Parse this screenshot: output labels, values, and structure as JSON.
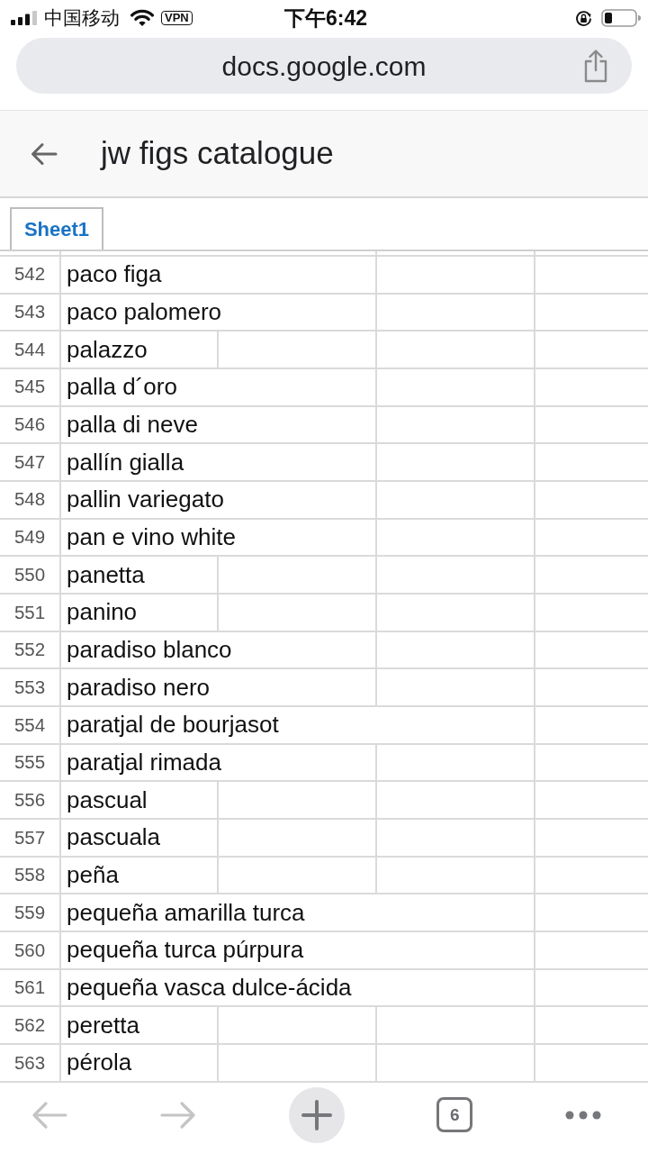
{
  "status_bar": {
    "carrier": "中国移动",
    "vpn": "VPN",
    "time": "下午6:42"
  },
  "address_bar": {
    "url": "docs.google.com"
  },
  "doc_header": {
    "title": "jw figs catalogue"
  },
  "sheet_tabs": [
    {
      "label": "Sheet1",
      "selected": true
    }
  ],
  "sheet": {
    "rows": [
      {
        "number": "542",
        "value": "paco figa",
        "kind": "double"
      },
      {
        "number": "543",
        "value": "paco palomero",
        "kind": "double"
      },
      {
        "number": "544",
        "value": "palazzo",
        "kind": "single"
      },
      {
        "number": "545",
        "value": "palla d´oro",
        "kind": "double"
      },
      {
        "number": "546",
        "value": "palla di neve",
        "kind": "double"
      },
      {
        "number": "547",
        "value": "pallín gialla",
        "kind": "double"
      },
      {
        "number": "548",
        "value": "pallin variegato",
        "kind": "double"
      },
      {
        "number": "549",
        "value": "pan e vino white",
        "kind": "double"
      },
      {
        "number": "550",
        "value": "panetta",
        "kind": "single"
      },
      {
        "number": "551",
        "value": "panino",
        "kind": "single"
      },
      {
        "number": "552",
        "value": "paradiso blanco",
        "kind": "double"
      },
      {
        "number": "553",
        "value": "paradiso nero",
        "kind": "double"
      },
      {
        "number": "554",
        "value": "paratjal de bourjasot",
        "kind": "triple"
      },
      {
        "number": "555",
        "value": "paratjal rimada",
        "kind": "double"
      },
      {
        "number": "556",
        "value": "pascual",
        "kind": "single"
      },
      {
        "number": "557",
        "value": "pascuala",
        "kind": "single"
      },
      {
        "number": "558",
        "value": "peña",
        "kind": "single"
      },
      {
        "number": "559",
        "value": "pequeña amarilla turca",
        "kind": "triple"
      },
      {
        "number": "560",
        "value": "pequeña turca púrpura",
        "kind": "triple"
      },
      {
        "number": "561",
        "value": "pequeña vasca dulce-ácida",
        "kind": "triple"
      },
      {
        "number": "562",
        "value": "peretta",
        "kind": "single"
      },
      {
        "number": "563",
        "value": "pérola",
        "kind": "single"
      }
    ]
  },
  "toolbar": {
    "back": {
      "disabled": true
    },
    "forward": {
      "disabled": true
    },
    "tab_count": "6"
  }
}
